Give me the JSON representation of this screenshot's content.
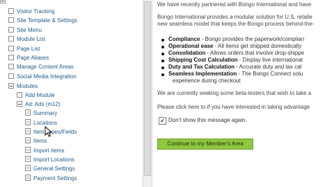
{
  "sidebar": {
    "items": [
      {
        "label": "Visitor Tracking"
      },
      {
        "label": "Site Template & Settings"
      },
      {
        "label": "Site Menu"
      },
      {
        "label": "Module List"
      },
      {
        "label": "Page List"
      },
      {
        "label": "Page Aliases"
      },
      {
        "label": "Manage Content Areas"
      },
      {
        "label": "Social Media Integration"
      },
      {
        "label": "Modules"
      },
      {
        "label": "Add Module"
      },
      {
        "label": "Ad: Ads (m12)"
      },
      {
        "label": "Summary"
      },
      {
        "label": "Locations"
      },
      {
        "label": "Item Types/Fields"
      },
      {
        "label": "Items"
      },
      {
        "label": "Import Items"
      },
      {
        "label": "Import Locations"
      },
      {
        "label": "General Settings"
      },
      {
        "label": "Payment Settings"
      }
    ]
  },
  "content": {
    "intro_line": "We have recently partnered with Bongo International and have",
    "para1_line1": "Bongo International provides a modular solution for U.S. retaile",
    "para1_line2": "new seamless model that keeps the Bongo process behind-the-",
    "features": [
      {
        "title": "Compliance",
        "text": " - Bongo provides the paperwork/complian"
      },
      {
        "title": "Operational ease",
        "text": " - All items get shipped domestically"
      },
      {
        "title": "Consolidation",
        "text": " - Allows orders that involve drop-shippe"
      },
      {
        "title": "Shipping Cost Calculation",
        "text": " - Display live international"
      },
      {
        "title": "Duty and Tax Calculation",
        "text": " - Accurate duty and tax cal"
      },
      {
        "title": "Seamless Implementation",
        "text": " - The Bongo Connect solu"
      },
      {
        "title": "",
        "text": "experience during checkout"
      }
    ],
    "beta_line": "We are currently seeking some beta-testers that wish to take a",
    "click_line": "Please click here to if you have interested in taking advantage",
    "dont_show_label": "Don't show this message again.",
    "continue_button": "Continue to my Member's Area"
  },
  "colors": {
    "link": "#1f5a8a",
    "button": "#8fc73e"
  }
}
